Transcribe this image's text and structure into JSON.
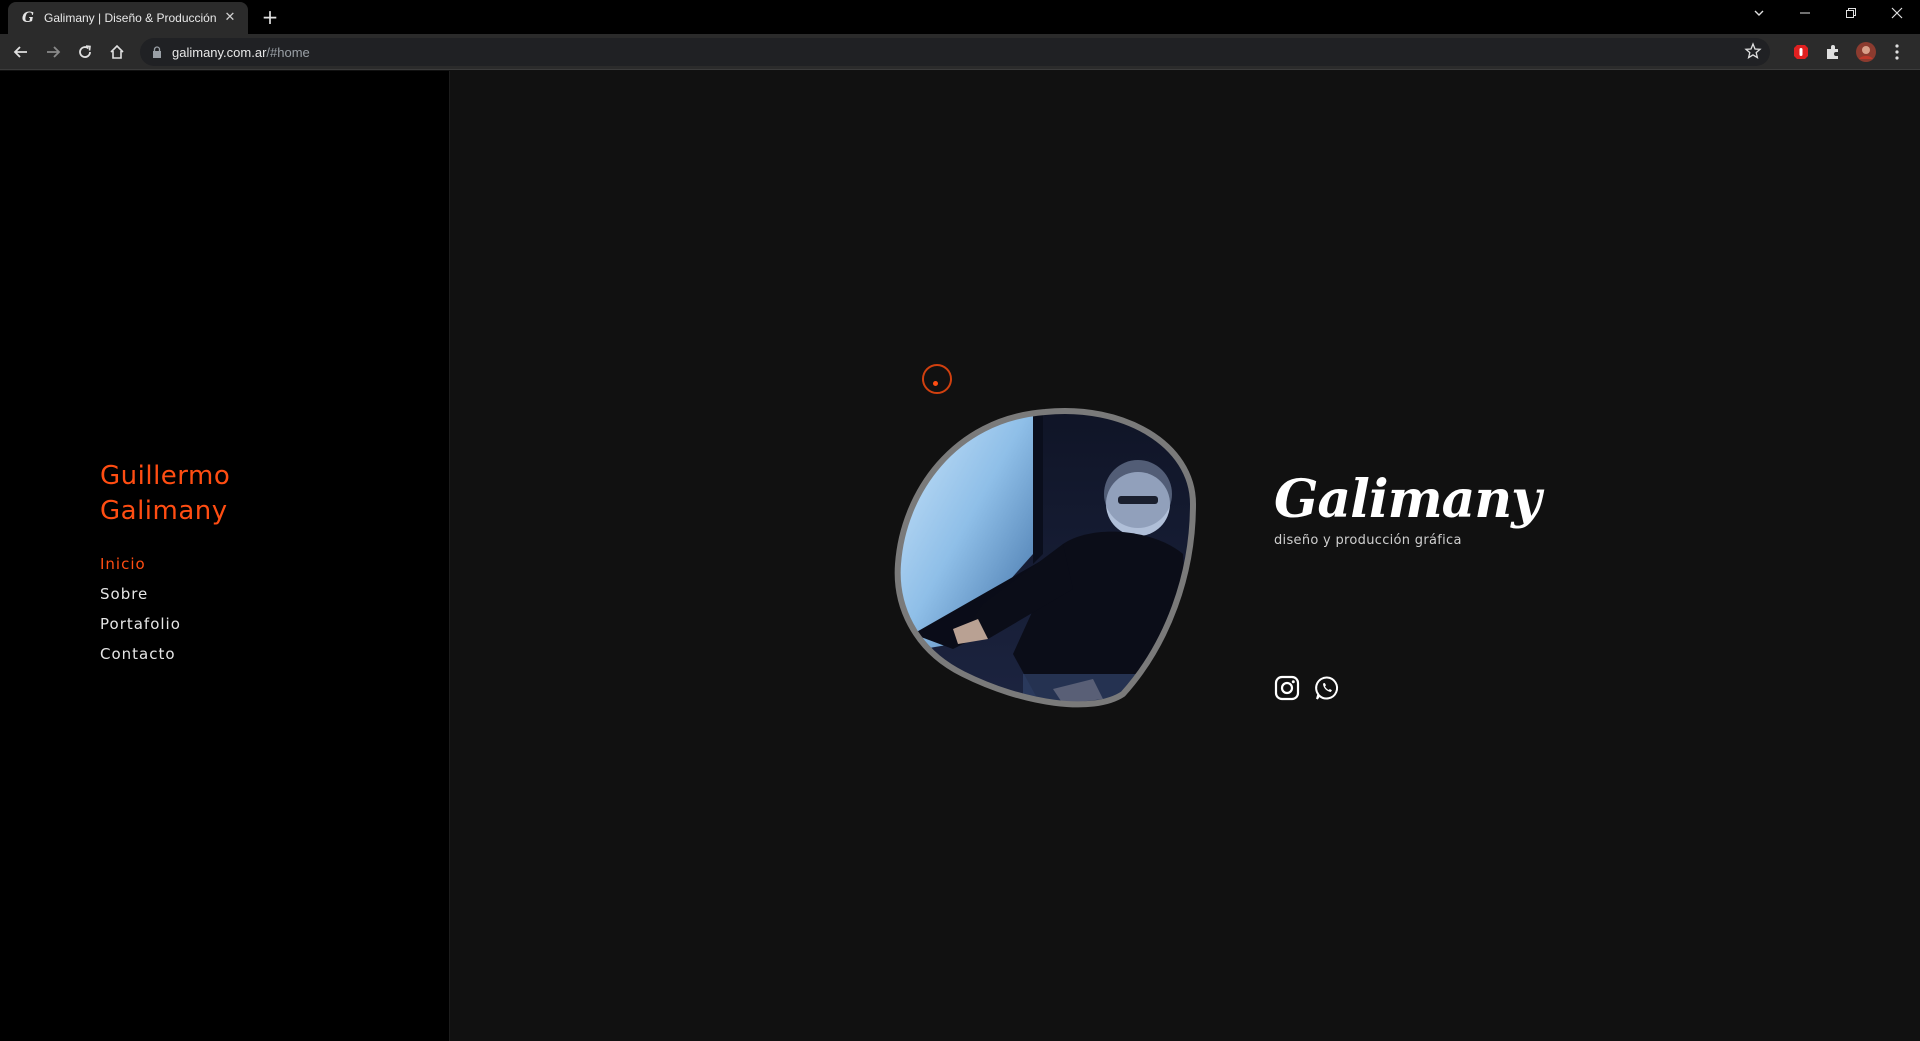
{
  "browser": {
    "tab_title": "Galimany | Diseño & Producción",
    "favicon_letter": "G",
    "url_host": "galimany.com.ar",
    "url_path": "/#home"
  },
  "sidebar": {
    "name_line1": "Guillermo",
    "name_line2": "Galimany",
    "nav": [
      {
        "label": "Inicio",
        "active": true
      },
      {
        "label": "Sobre",
        "active": false
      },
      {
        "label": "Portafolio",
        "active": false
      },
      {
        "label": "Contacto",
        "active": false
      }
    ]
  },
  "hero": {
    "logo_text": "Galimany",
    "tagline": "diseño y producción gráfica",
    "social_icons": [
      "instagram-icon",
      "whatsapp-icon"
    ]
  },
  "colors": {
    "accent": "#ff4d12",
    "sidebar_bg": "#000000",
    "main_bg": "#111111",
    "text": "#e6e6e6"
  }
}
